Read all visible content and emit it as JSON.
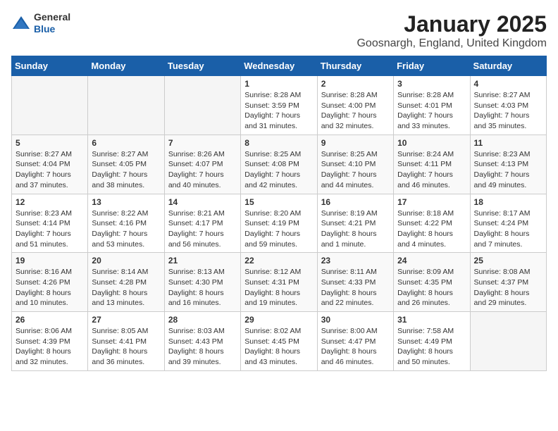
{
  "logo": {
    "general": "General",
    "blue": "Blue"
  },
  "title": "January 2025",
  "subtitle": "Goosnargh, England, United Kingdom",
  "headers": [
    "Sunday",
    "Monday",
    "Tuesday",
    "Wednesday",
    "Thursday",
    "Friday",
    "Saturday"
  ],
  "weeks": [
    [
      {
        "day": "",
        "sunrise": "",
        "sunset": "",
        "daylight": "",
        "empty": true
      },
      {
        "day": "",
        "sunrise": "",
        "sunset": "",
        "daylight": "",
        "empty": true
      },
      {
        "day": "",
        "sunrise": "",
        "sunset": "",
        "daylight": "",
        "empty": true
      },
      {
        "day": "1",
        "sunrise": "Sunrise: 8:28 AM",
        "sunset": "Sunset: 3:59 PM",
        "daylight": "Daylight: 7 hours and 31 minutes."
      },
      {
        "day": "2",
        "sunrise": "Sunrise: 8:28 AM",
        "sunset": "Sunset: 4:00 PM",
        "daylight": "Daylight: 7 hours and 32 minutes."
      },
      {
        "day": "3",
        "sunrise": "Sunrise: 8:28 AM",
        "sunset": "Sunset: 4:01 PM",
        "daylight": "Daylight: 7 hours and 33 minutes."
      },
      {
        "day": "4",
        "sunrise": "Sunrise: 8:27 AM",
        "sunset": "Sunset: 4:03 PM",
        "daylight": "Daylight: 7 hours and 35 minutes."
      }
    ],
    [
      {
        "day": "5",
        "sunrise": "Sunrise: 8:27 AM",
        "sunset": "Sunset: 4:04 PM",
        "daylight": "Daylight: 7 hours and 37 minutes."
      },
      {
        "day": "6",
        "sunrise": "Sunrise: 8:27 AM",
        "sunset": "Sunset: 4:05 PM",
        "daylight": "Daylight: 7 hours and 38 minutes."
      },
      {
        "day": "7",
        "sunrise": "Sunrise: 8:26 AM",
        "sunset": "Sunset: 4:07 PM",
        "daylight": "Daylight: 7 hours and 40 minutes."
      },
      {
        "day": "8",
        "sunrise": "Sunrise: 8:25 AM",
        "sunset": "Sunset: 4:08 PM",
        "daylight": "Daylight: 7 hours and 42 minutes."
      },
      {
        "day": "9",
        "sunrise": "Sunrise: 8:25 AM",
        "sunset": "Sunset: 4:10 PM",
        "daylight": "Daylight: 7 hours and 44 minutes."
      },
      {
        "day": "10",
        "sunrise": "Sunrise: 8:24 AM",
        "sunset": "Sunset: 4:11 PM",
        "daylight": "Daylight: 7 hours and 46 minutes."
      },
      {
        "day": "11",
        "sunrise": "Sunrise: 8:23 AM",
        "sunset": "Sunset: 4:13 PM",
        "daylight": "Daylight: 7 hours and 49 minutes."
      }
    ],
    [
      {
        "day": "12",
        "sunrise": "Sunrise: 8:23 AM",
        "sunset": "Sunset: 4:14 PM",
        "daylight": "Daylight: 7 hours and 51 minutes."
      },
      {
        "day": "13",
        "sunrise": "Sunrise: 8:22 AM",
        "sunset": "Sunset: 4:16 PM",
        "daylight": "Daylight: 7 hours and 53 minutes."
      },
      {
        "day": "14",
        "sunrise": "Sunrise: 8:21 AM",
        "sunset": "Sunset: 4:17 PM",
        "daylight": "Daylight: 7 hours and 56 minutes."
      },
      {
        "day": "15",
        "sunrise": "Sunrise: 8:20 AM",
        "sunset": "Sunset: 4:19 PM",
        "daylight": "Daylight: 7 hours and 59 minutes."
      },
      {
        "day": "16",
        "sunrise": "Sunrise: 8:19 AM",
        "sunset": "Sunset: 4:21 PM",
        "daylight": "Daylight: 8 hours and 1 minute."
      },
      {
        "day": "17",
        "sunrise": "Sunrise: 8:18 AM",
        "sunset": "Sunset: 4:22 PM",
        "daylight": "Daylight: 8 hours and 4 minutes."
      },
      {
        "day": "18",
        "sunrise": "Sunrise: 8:17 AM",
        "sunset": "Sunset: 4:24 PM",
        "daylight": "Daylight: 8 hours and 7 minutes."
      }
    ],
    [
      {
        "day": "19",
        "sunrise": "Sunrise: 8:16 AM",
        "sunset": "Sunset: 4:26 PM",
        "daylight": "Daylight: 8 hours and 10 minutes."
      },
      {
        "day": "20",
        "sunrise": "Sunrise: 8:14 AM",
        "sunset": "Sunset: 4:28 PM",
        "daylight": "Daylight: 8 hours and 13 minutes."
      },
      {
        "day": "21",
        "sunrise": "Sunrise: 8:13 AM",
        "sunset": "Sunset: 4:30 PM",
        "daylight": "Daylight: 8 hours and 16 minutes."
      },
      {
        "day": "22",
        "sunrise": "Sunrise: 8:12 AM",
        "sunset": "Sunset: 4:31 PM",
        "daylight": "Daylight: 8 hours and 19 minutes."
      },
      {
        "day": "23",
        "sunrise": "Sunrise: 8:11 AM",
        "sunset": "Sunset: 4:33 PM",
        "daylight": "Daylight: 8 hours and 22 minutes."
      },
      {
        "day": "24",
        "sunrise": "Sunrise: 8:09 AM",
        "sunset": "Sunset: 4:35 PM",
        "daylight": "Daylight: 8 hours and 26 minutes."
      },
      {
        "day": "25",
        "sunrise": "Sunrise: 8:08 AM",
        "sunset": "Sunset: 4:37 PM",
        "daylight": "Daylight: 8 hours and 29 minutes."
      }
    ],
    [
      {
        "day": "26",
        "sunrise": "Sunrise: 8:06 AM",
        "sunset": "Sunset: 4:39 PM",
        "daylight": "Daylight: 8 hours and 32 minutes."
      },
      {
        "day": "27",
        "sunrise": "Sunrise: 8:05 AM",
        "sunset": "Sunset: 4:41 PM",
        "daylight": "Daylight: 8 hours and 36 minutes."
      },
      {
        "day": "28",
        "sunrise": "Sunrise: 8:03 AM",
        "sunset": "Sunset: 4:43 PM",
        "daylight": "Daylight: 8 hours and 39 minutes."
      },
      {
        "day": "29",
        "sunrise": "Sunrise: 8:02 AM",
        "sunset": "Sunset: 4:45 PM",
        "daylight": "Daylight: 8 hours and 43 minutes."
      },
      {
        "day": "30",
        "sunrise": "Sunrise: 8:00 AM",
        "sunset": "Sunset: 4:47 PM",
        "daylight": "Daylight: 8 hours and 46 minutes."
      },
      {
        "day": "31",
        "sunrise": "Sunrise: 7:58 AM",
        "sunset": "Sunset: 4:49 PM",
        "daylight": "Daylight: 8 hours and 50 minutes."
      },
      {
        "day": "",
        "sunrise": "",
        "sunset": "",
        "daylight": "",
        "empty": true
      }
    ]
  ]
}
